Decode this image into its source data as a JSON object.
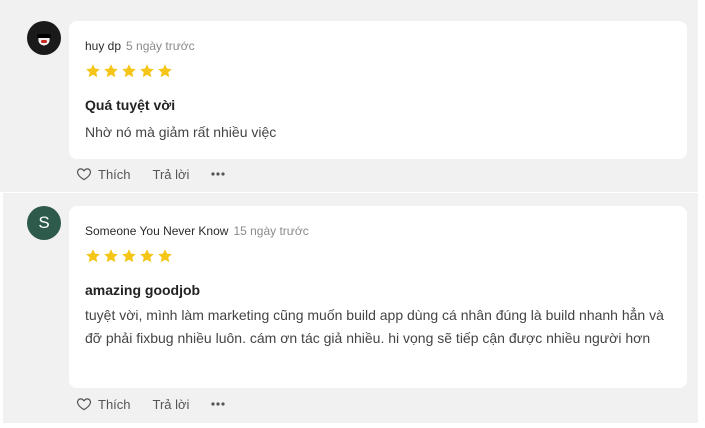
{
  "reviews": [
    {
      "author": "huy dp",
      "time": "5 ngày trước",
      "rating": 5,
      "title": "Quá tuyệt vời",
      "text": "Nhờ nó mà giảm rất nhiều việc",
      "avatar": {
        "type": "photo"
      },
      "actions": {
        "like": "Thích",
        "reply": "Trả lời",
        "more_icon": "more-horizontal-icon"
      }
    },
    {
      "author": "Someone You Never Know",
      "time": "15 ngày trước",
      "rating": 5,
      "title": "amazing goodjob",
      "text": "tuyệt vời, mình làm marketing cũng muốn build app dùng cá nhân đúng là build nhanh hẳn và đỡ phải fixbug nhiều luôn. cám ơn tác giả nhiều. hi vọng sẽ tiếp cận được nhiều người hơn",
      "avatar": {
        "type": "letter",
        "letter": "S",
        "color": "#2d5a4a"
      },
      "actions": {
        "like": "Thích",
        "reply": "Trả lời",
        "more_icon": "more-horizontal-icon"
      }
    }
  ],
  "colors": {
    "star": "#f5c518",
    "block_bg": "#f1f1f1",
    "card_bg": "#ffffff"
  }
}
